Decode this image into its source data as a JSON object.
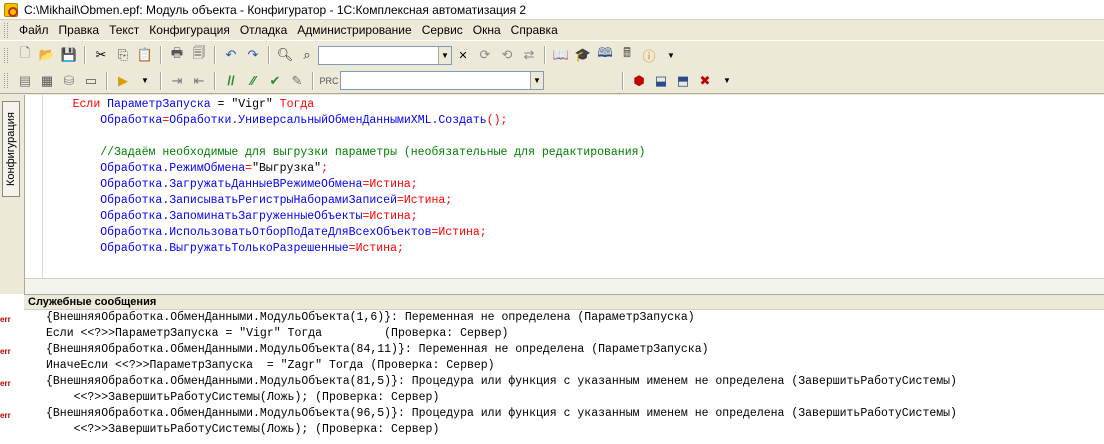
{
  "window": {
    "title": "C:\\Mikhail\\Obmen.epf: Модуль объекта - Конфигуратор - 1С:Комплексная автоматизация 2"
  },
  "menu": [
    {
      "label": "Файл"
    },
    {
      "label": "Правка"
    },
    {
      "label": "Текст"
    },
    {
      "label": "Конфигурация"
    },
    {
      "label": "Отладка"
    },
    {
      "label": "Администрирование"
    },
    {
      "label": "Сервис"
    },
    {
      "label": "Окна"
    },
    {
      "label": "Справка"
    }
  ],
  "toolbar": {
    "search_combo_value": "",
    "proc_combo_value": ""
  },
  "side_tab": {
    "label": "Конфигурация"
  },
  "code": {
    "lines": [
      {
        "indent": "    ",
        "parts": [
          [
            "kw",
            "Если "
          ],
          [
            "id",
            "ПараметрЗапуска"
          ],
          [
            "str",
            " = \"Vigr\" "
          ],
          [
            "kw",
            "Тогда"
          ]
        ]
      },
      {
        "indent": "        ",
        "parts": [
          [
            "id",
            "Обработка"
          ],
          [
            "kw",
            "="
          ],
          [
            "id",
            "Обработки.УниверсальныйОбменДаннымиXML.Создать"
          ],
          [
            "kw",
            "();"
          ]
        ]
      },
      {
        "indent": "",
        "parts": []
      },
      {
        "indent": "        ",
        "parts": [
          [
            "cmt",
            "//Задаём необходимые для выгрузки параметры (необязательные для редактирования)"
          ]
        ]
      },
      {
        "indent": "        ",
        "parts": [
          [
            "id",
            "Обработка.РежимОбмена"
          ],
          [
            "kw",
            "="
          ],
          [
            "str",
            "\"Выгрузка\""
          ],
          [
            "kw",
            ";"
          ]
        ]
      },
      {
        "indent": "        ",
        "parts": [
          [
            "id",
            "Обработка.ЗагружатьДанныеВРежимеОбмена"
          ],
          [
            "kw",
            "=Истина;"
          ]
        ]
      },
      {
        "indent": "        ",
        "parts": [
          [
            "id",
            "Обработка.ЗаписыватьРегистрыНаборамиЗаписей"
          ],
          [
            "kw",
            "=Истина;"
          ]
        ]
      },
      {
        "indent": "        ",
        "parts": [
          [
            "id",
            "Обработка.ЗапоминатьЗагруженныеОбъекты"
          ],
          [
            "kw",
            "=Истина;"
          ]
        ]
      },
      {
        "indent": "        ",
        "parts": [
          [
            "id",
            "Обработка.ИспользоватьОтборПоДатеДляВсехОбъектов"
          ],
          [
            "kw",
            "=Истина;"
          ]
        ]
      },
      {
        "indent": "        ",
        "parts": [
          [
            "id",
            "Обработка.ВыгружатьТолькоРазрешенные"
          ],
          [
            "kw",
            "=Истина;"
          ]
        ]
      }
    ]
  },
  "messages": {
    "header": "Служебные сообщения",
    "err_label": "err",
    "lines": [
      {
        "err": true,
        "text": "{ВнешняяОбработка.ОбменДанными.МодульОбъекта(1,6)}: Переменная не определена (ПараметрЗапуска)"
      },
      {
        "err": false,
        "text": "Если <<?>>ПараметрЗапуска = \"Vigr\" Тогда         (Проверка: Сервер)"
      },
      {
        "err": true,
        "text": "{ВнешняяОбработка.ОбменДанными.МодульОбъекта(84,11)}: Переменная не определена (ПараметрЗапуска)"
      },
      {
        "err": false,
        "text": "ИначеЕсли <<?>>ПараметрЗапуска  = \"Zagr\" Тогда (Проверка: Сервер)"
      },
      {
        "err": true,
        "text": "{ВнешняяОбработка.ОбменДанными.МодульОбъекта(81,5)}: Процедура или функция с указанным именем не определена (ЗавершитьРаботуСистемы)"
      },
      {
        "err": false,
        "text": "    <<?>>ЗавершитьРаботуСистемы(Ложь); (Проверка: Сервер)"
      },
      {
        "err": true,
        "text": "{ВнешняяОбработка.ОбменДанными.МодульОбъекта(96,5)}: Процедура или функция с указанным именем не определена (ЗавершитьРаботуСистемы)"
      },
      {
        "err": false,
        "text": "    <<?>>ЗавершитьРаботуСистемы(Ложь); (Проверка: Сервер)"
      }
    ]
  }
}
